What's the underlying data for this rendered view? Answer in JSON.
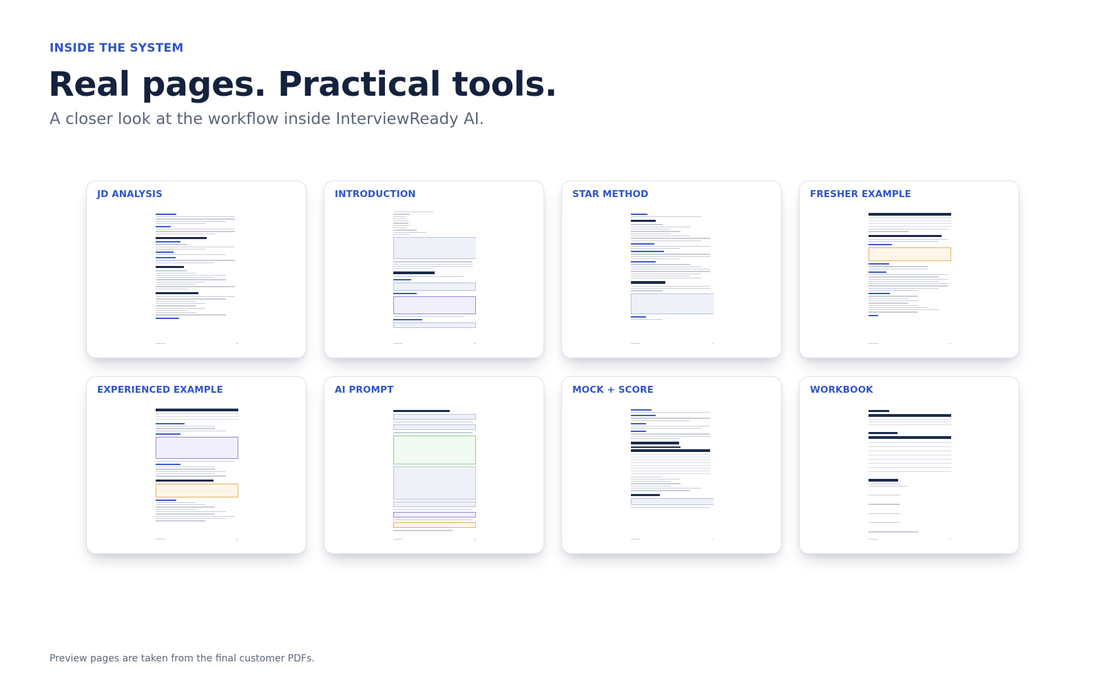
{
  "header": {
    "eyebrow": "INSIDE THE SYSTEM",
    "headline": "Real pages. Practical tools.",
    "subhead": "A closer look at the workflow inside InterviewReady AI."
  },
  "cards": [
    {
      "label": "JD ANALYSIS"
    },
    {
      "label": "INTRODUCTION"
    },
    {
      "label": "STAR METHOD"
    },
    {
      "label": "FRESHER EXAMPLE"
    },
    {
      "label": "EXPERIENCED EXAMPLE"
    },
    {
      "label": "AI PROMPT"
    },
    {
      "label": "MOCK + SCORE"
    },
    {
      "label": "WORKBOOK"
    }
  ],
  "footer": {
    "note": "Preview pages are taken from the final customer PDFs."
  },
  "colors": {
    "accent": "#2f55c8",
    "heading": "#14223d",
    "muted": "#5b6678"
  }
}
